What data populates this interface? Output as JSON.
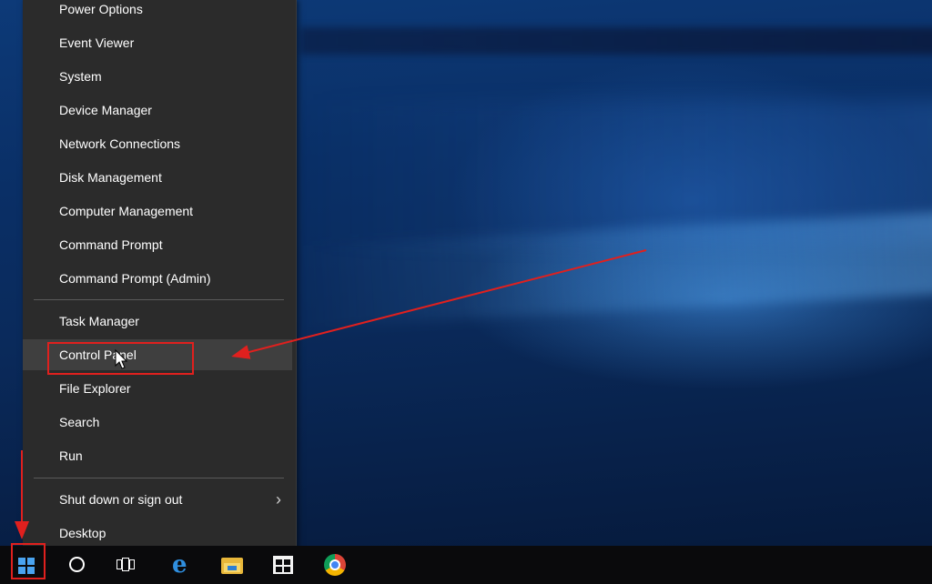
{
  "menu": {
    "items": [
      {
        "label": "Power Options"
      },
      {
        "label": "Event Viewer"
      },
      {
        "label": "System"
      },
      {
        "label": "Device Manager"
      },
      {
        "label": "Network Connections"
      },
      {
        "label": "Disk Management"
      },
      {
        "label": "Computer Management"
      },
      {
        "label": "Command Prompt"
      },
      {
        "label": "Command Prompt (Admin)"
      },
      {
        "label": "Task Manager"
      },
      {
        "label": "Control Panel"
      },
      {
        "label": "File Explorer"
      },
      {
        "label": "Search"
      },
      {
        "label": "Run"
      },
      {
        "label": "Shut down or sign out"
      },
      {
        "label": "Desktop"
      }
    ],
    "highlighted": "Control Panel",
    "submenu_chevron": "›"
  },
  "taskbar": {
    "icons": [
      "windows-start-icon",
      "cortana-icon",
      "task-view-icon",
      "edge-icon",
      "file-explorer-icon",
      "store-icon",
      "chrome-icon"
    ],
    "edge_glyph": "e"
  },
  "annotations": {
    "color": "#e0201e",
    "accent": "#4aa3f0"
  }
}
